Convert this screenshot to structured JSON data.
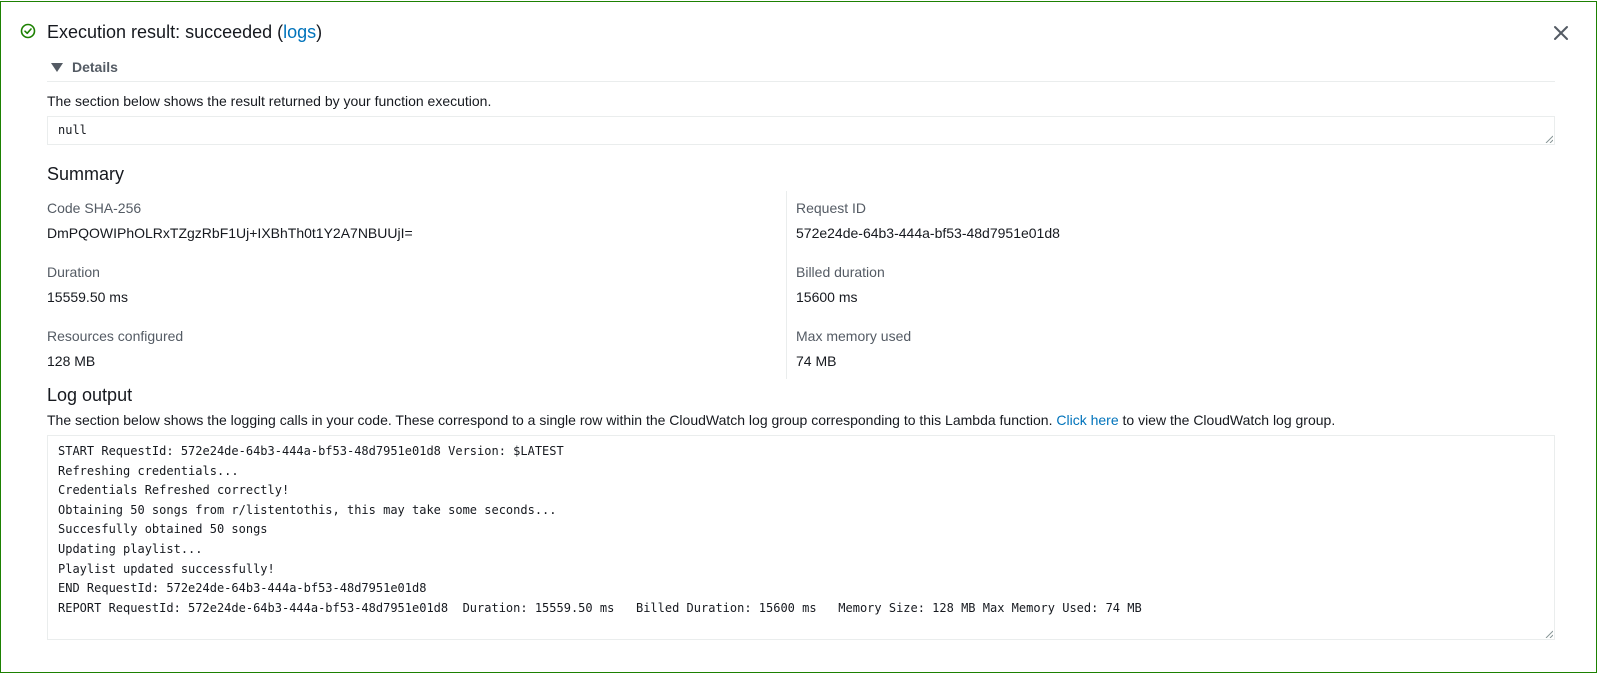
{
  "header": {
    "title_prefix": "Execution result: succeeded (",
    "logs_link": "logs",
    "title_suffix": ")",
    "accent": "#1d8102"
  },
  "icons": {
    "success": "check-circle-icon",
    "close": "close-icon",
    "caret": "caret-down-icon"
  },
  "details": {
    "label": "Details",
    "result_description": "The section below shows the result returned by your function execution.",
    "result_value": "null"
  },
  "summary": {
    "title": "Summary",
    "left": [
      {
        "label": "Code SHA-256",
        "value": "DmPQOWIPhOLRxTZgzRbF1Uj+IXBhTh0t1Y2A7NBUUjI="
      },
      {
        "label": "Duration",
        "value": "15559.50 ms"
      },
      {
        "label": "Resources configured",
        "value": "128 MB"
      }
    ],
    "right": [
      {
        "label": "Request ID",
        "value": "572e24de-64b3-444a-bf53-48d7951e01d8"
      },
      {
        "label": "Billed duration",
        "value": "15600 ms"
      },
      {
        "label": "Max memory used",
        "value": "74 MB"
      }
    ]
  },
  "log_output": {
    "title": "Log output",
    "description_prefix": "The section below shows the logging calls in your code. These correspond to a single row within the CloudWatch log group corresponding to this Lambda function. ",
    "link_text": "Click here",
    "description_suffix": " to view the CloudWatch log group.",
    "lines": [
      "START RequestId: 572e24de-64b3-444a-bf53-48d7951e01d8 Version: $LATEST",
      "Refreshing credentials...",
      "Credentials Refreshed correctly!",
      "Obtaining 50 songs from r/listentothis, this may take some seconds...",
      "Succesfully obtained 50 songs",
      "Updating playlist...",
      "Playlist updated successfully!",
      "END RequestId: 572e24de-64b3-444a-bf53-48d7951e01d8",
      "REPORT RequestId: 572e24de-64b3-444a-bf53-48d7951e01d8\tDuration: 15559.50 ms\tBilled Duration: 15600 ms\tMemory Size: 128 MB\tMax Memory Used: 74 MB\t"
    ]
  }
}
